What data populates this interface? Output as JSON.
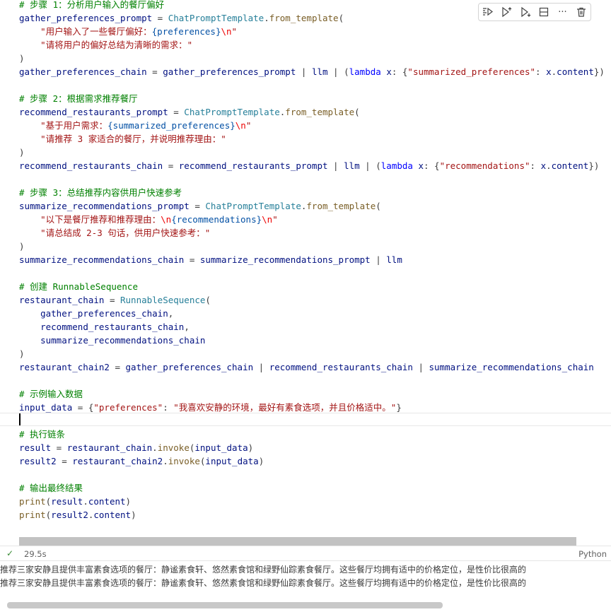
{
  "toolbar": {
    "icons": [
      "run-by-line-icon",
      "execute-above-icon",
      "execute-below-icon",
      "split-cell-icon",
      "more-actions-icon",
      "delete-icon"
    ],
    "more_label": "···"
  },
  "code_lines": [
    [
      [
        "c",
        "# 步骤 1：分析用户输入的餐厅偏好"
      ]
    ],
    [
      [
        "v",
        "gather_preferences_prompt"
      ],
      [
        "o",
        " = "
      ],
      [
        "t",
        "ChatPromptTemplate"
      ],
      [
        "o",
        "."
      ],
      [
        "f",
        "from_template"
      ],
      [
        "o",
        "("
      ]
    ],
    [
      [
        "o",
        "    "
      ],
      [
        "s",
        "\"用户输入了一些餐厅偏好："
      ],
      [
        "p",
        "{preferences}"
      ],
      [
        "e",
        "\\n"
      ],
      [
        "s",
        "\""
      ]
    ],
    [
      [
        "o",
        "    "
      ],
      [
        "s",
        "\"请将用户的偏好总结为清晰的需求：\""
      ]
    ],
    [
      [
        "o",
        ")"
      ]
    ],
    [
      [
        "v",
        "gather_preferences_chain"
      ],
      [
        "o",
        " = "
      ],
      [
        "v",
        "gather_preferences_prompt"
      ],
      [
        "o",
        " | "
      ],
      [
        "v",
        "llm"
      ],
      [
        "o",
        " | ("
      ],
      [
        "k",
        "lambda"
      ],
      [
        "o",
        " "
      ],
      [
        "v",
        "x"
      ],
      [
        "o",
        ": {"
      ],
      [
        "s",
        "\"summarized_preferences\""
      ],
      [
        "o",
        ": "
      ],
      [
        "v",
        "x"
      ],
      [
        "o",
        "."
      ],
      [
        "v",
        "content"
      ],
      [
        "o",
        "})"
      ]
    ],
    [],
    [
      [
        "c",
        "# 步骤 2：根据需求推荐餐厅"
      ]
    ],
    [
      [
        "v",
        "recommend_restaurants_prompt"
      ],
      [
        "o",
        " = "
      ],
      [
        "t",
        "ChatPromptTemplate"
      ],
      [
        "o",
        "."
      ],
      [
        "f",
        "from_template"
      ],
      [
        "o",
        "("
      ]
    ],
    [
      [
        "o",
        "    "
      ],
      [
        "s",
        "\"基于用户需求："
      ],
      [
        "p",
        "{summarized_preferences}"
      ],
      [
        "e",
        "\\n"
      ],
      [
        "s",
        "\""
      ]
    ],
    [
      [
        "o",
        "    "
      ],
      [
        "s",
        "\"请推荐 3 家适合的餐厅，并说明推荐理由：\""
      ]
    ],
    [
      [
        "o",
        ")"
      ]
    ],
    [
      [
        "v",
        "recommend_restaurants_chain"
      ],
      [
        "o",
        " = "
      ],
      [
        "v",
        "recommend_restaurants_prompt"
      ],
      [
        "o",
        " | "
      ],
      [
        "v",
        "llm"
      ],
      [
        "o",
        " | ("
      ],
      [
        "k",
        "lambda"
      ],
      [
        "o",
        " "
      ],
      [
        "v",
        "x"
      ],
      [
        "o",
        ": {"
      ],
      [
        "s",
        "\"recommendations\""
      ],
      [
        "o",
        ": "
      ],
      [
        "v",
        "x"
      ],
      [
        "o",
        "."
      ],
      [
        "v",
        "content"
      ],
      [
        "o",
        "})"
      ]
    ],
    [],
    [
      [
        "c",
        "# 步骤 3：总结推荐内容供用户快速参考"
      ]
    ],
    [
      [
        "v",
        "summarize_recommendations_prompt"
      ],
      [
        "o",
        " = "
      ],
      [
        "t",
        "ChatPromptTemplate"
      ],
      [
        "o",
        "."
      ],
      [
        "f",
        "from_template"
      ],
      [
        "o",
        "("
      ]
    ],
    [
      [
        "o",
        "    "
      ],
      [
        "s",
        "\"以下是餐厅推荐和推荐理由："
      ],
      [
        "e",
        "\\n"
      ],
      [
        "p",
        "{recommendations}"
      ],
      [
        "e",
        "\\n"
      ],
      [
        "s",
        "\""
      ]
    ],
    [
      [
        "o",
        "    "
      ],
      [
        "s",
        "\"请总结成 2-3 句话，供用户快速参考：\""
      ]
    ],
    [
      [
        "o",
        ")"
      ]
    ],
    [
      [
        "v",
        "summarize_recommendations_chain"
      ],
      [
        "o",
        " = "
      ],
      [
        "v",
        "summarize_recommendations_prompt"
      ],
      [
        "o",
        " | "
      ],
      [
        "v",
        "llm"
      ]
    ],
    [],
    [
      [
        "c",
        "# 创建 RunnableSequence"
      ]
    ],
    [
      [
        "v",
        "restaurant_chain"
      ],
      [
        "o",
        " = "
      ],
      [
        "t",
        "RunnableSequence"
      ],
      [
        "o",
        "("
      ]
    ],
    [
      [
        "o",
        "    "
      ],
      [
        "v",
        "gather_preferences_chain"
      ],
      [
        "o",
        ","
      ]
    ],
    [
      [
        "o",
        "    "
      ],
      [
        "v",
        "recommend_restaurants_chain"
      ],
      [
        "o",
        ","
      ]
    ],
    [
      [
        "o",
        "    "
      ],
      [
        "v",
        "summarize_recommendations_chain"
      ]
    ],
    [
      [
        "o",
        ")"
      ]
    ],
    [
      [
        "v",
        "restaurant_chain2"
      ],
      [
        "o",
        " = "
      ],
      [
        "v",
        "gather_preferences_chain"
      ],
      [
        "o",
        " | "
      ],
      [
        "v",
        "recommend_restaurants_chain"
      ],
      [
        "o",
        " | "
      ],
      [
        "v",
        "summarize_recommendations_chain"
      ]
    ],
    [],
    [
      [
        "c",
        "# 示例输入数据"
      ]
    ],
    [
      [
        "v",
        "input_data"
      ],
      [
        "o",
        " = {"
      ],
      [
        "s",
        "\"preferences\""
      ],
      [
        "o",
        ": "
      ],
      [
        "s",
        "\"我喜欢安静的环境，最好有素食选项，并且价格适中。\""
      ],
      [
        "o",
        "}"
      ]
    ],
    [],
    [
      [
        "c",
        "# 执行链条"
      ]
    ],
    [
      [
        "v",
        "result"
      ],
      [
        "o",
        " = "
      ],
      [
        "v",
        "restaurant_chain"
      ],
      [
        "o",
        "."
      ],
      [
        "f",
        "invoke"
      ],
      [
        "o",
        "("
      ],
      [
        "v",
        "input_data"
      ],
      [
        "o",
        ")"
      ]
    ],
    [
      [
        "v",
        "result2"
      ],
      [
        "o",
        " = "
      ],
      [
        "v",
        "restaurant_chain2"
      ],
      [
        "o",
        "."
      ],
      [
        "f",
        "invoke"
      ],
      [
        "o",
        "("
      ],
      [
        "v",
        "input_data"
      ],
      [
        "o",
        ")"
      ]
    ],
    [],
    [
      [
        "c",
        "# 输出最终结果"
      ]
    ],
    [
      [
        "f",
        "print"
      ],
      [
        "o",
        "("
      ],
      [
        "v",
        "result"
      ],
      [
        "o",
        "."
      ],
      [
        "v",
        "content"
      ],
      [
        "o",
        ")"
      ]
    ],
    [
      [
        "f",
        "print"
      ],
      [
        "o",
        "("
      ],
      [
        "v",
        "result2"
      ],
      [
        "o",
        "."
      ],
      [
        "v",
        "content"
      ],
      [
        "o",
        ")"
      ]
    ]
  ],
  "status": {
    "check": "✓",
    "exec_time": "29.5s",
    "language": "Python"
  },
  "output_lines": [
    "推荐三家安静且提供丰富素食选项的餐厅：静谧素食轩、悠然素食馆和绿野仙踪素食餐厅。这些餐厅均拥有适中的价格定位，是性价比很高的",
    "推荐三家安静且提供丰富素食选项的餐厅：静谧素食轩、悠然素食馆和绿野仙踪素食餐厅。这些餐厅均拥有适中的价格定位，是性价比很高的"
  ]
}
